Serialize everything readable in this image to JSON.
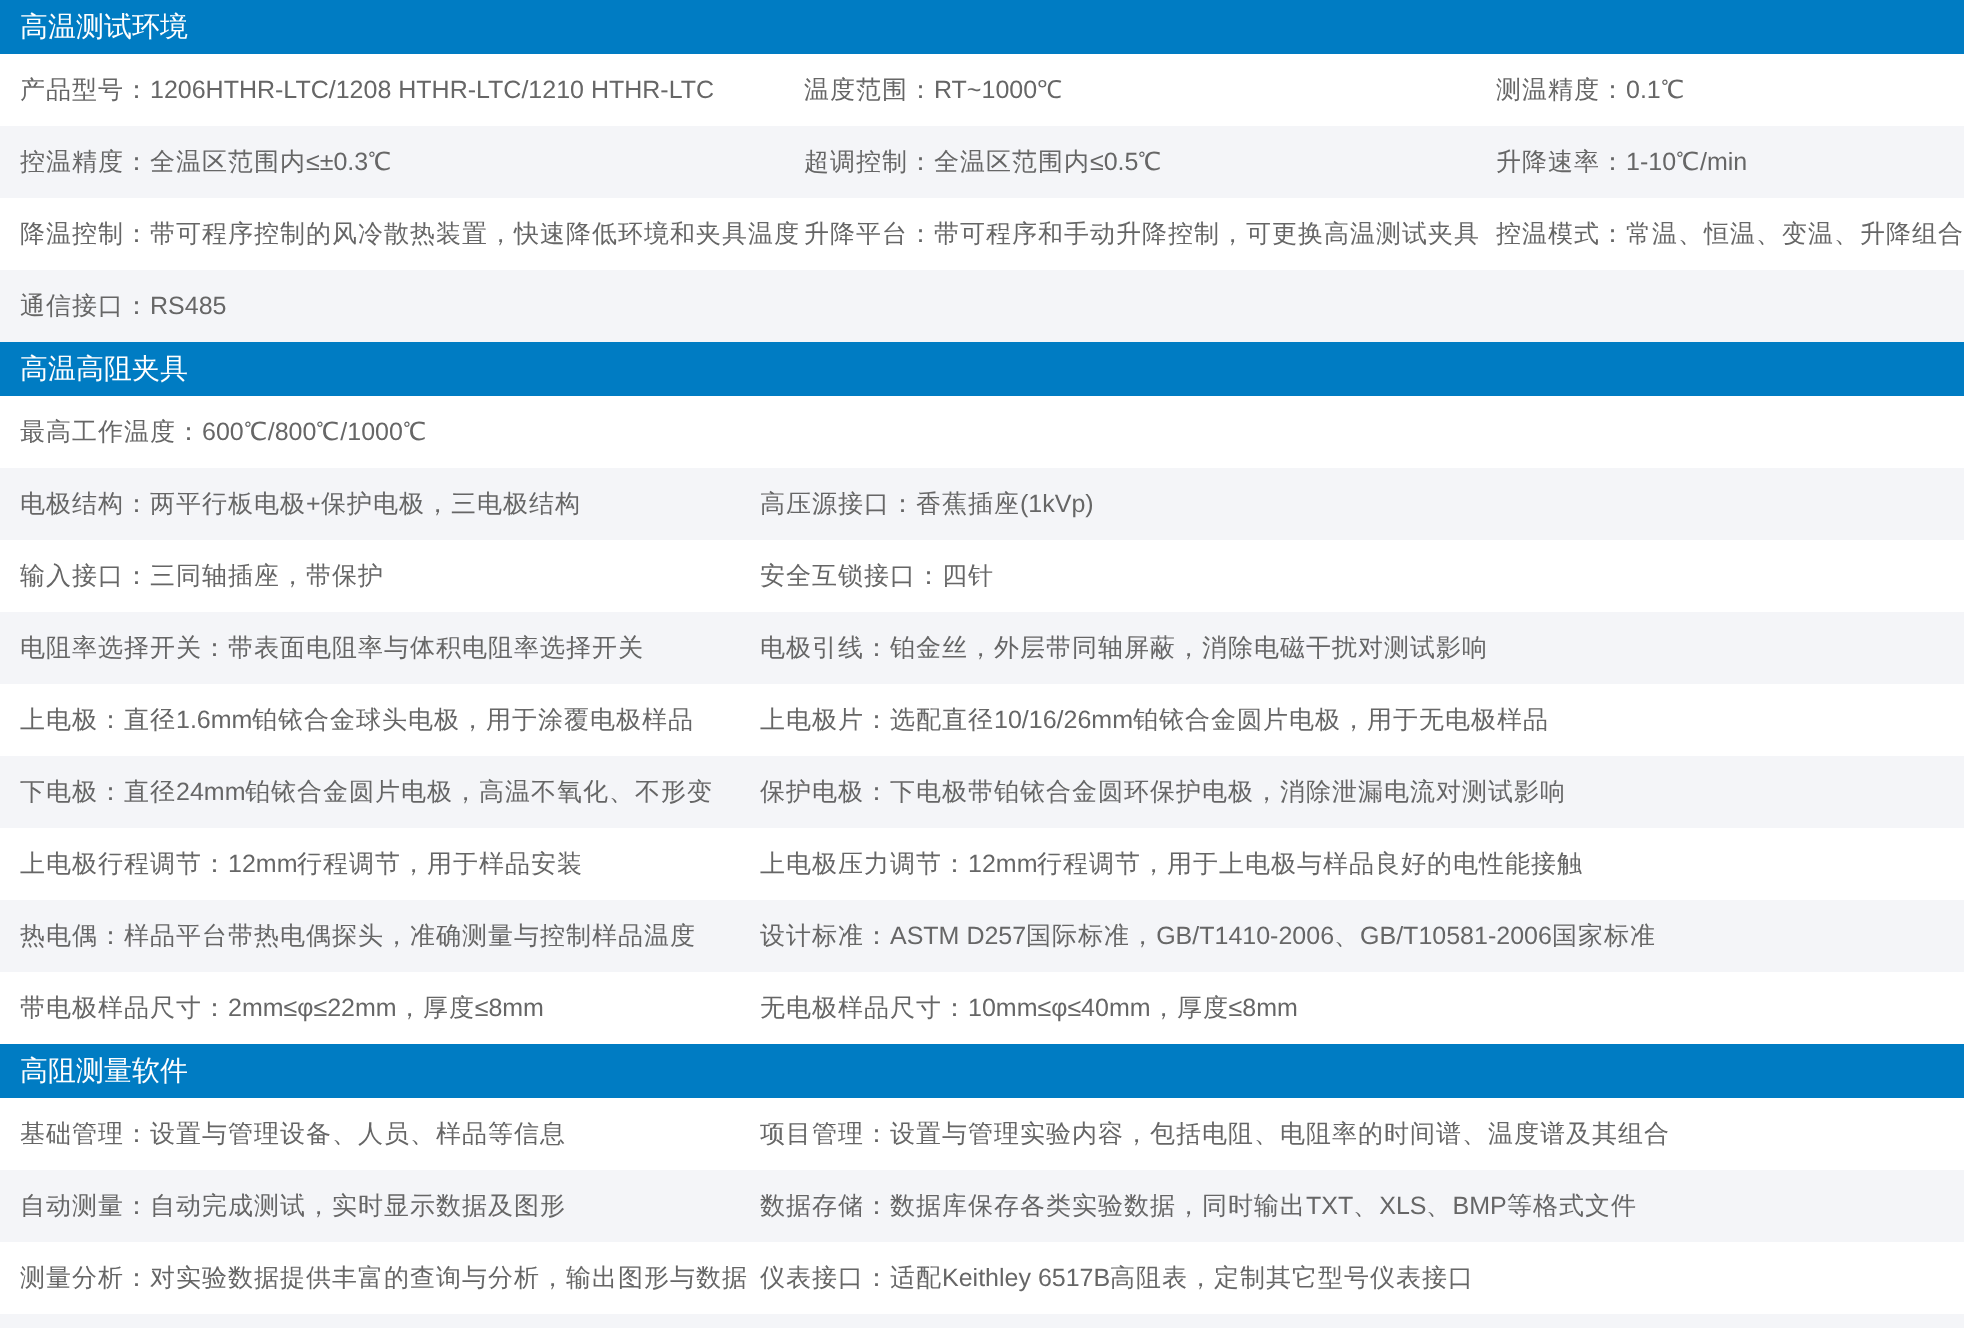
{
  "sections": [
    {
      "title": "高温测试环境",
      "kind": "three-column",
      "rows": [
        {
          "cells": [
            "产品型号：1206HTHR-LTC/1208 HTHR-LTC/1210 HTHR-LTC",
            "温度范围：RT~1000℃",
            "测温精度：0.1℃"
          ]
        },
        {
          "cells": [
            "控温精度：全温区范围内≤±0.3℃",
            "超调控制：全温区范围内≤0.5℃",
            "升降速率：1-10℃/min"
          ]
        },
        {
          "cells": [
            "降温控制：带可程序控制的风冷散热装置，快速降低环境和夹具温度",
            "升降平台：带可程序和手动升降控制，可更换高温测试夹具",
            "控温模式：常温、恒温、变温、升降组合"
          ]
        },
        {
          "cells": [
            "通信接口：RS485"
          ]
        }
      ]
    },
    {
      "title": "高温高阻夹具",
      "kind": "two-column",
      "rows": [
        {
          "cells": [
            "最高工作温度：600℃/800℃/1000℃"
          ]
        },
        {
          "cells": [
            "电极结构：两平行板电极+保护电极，三电极结构",
            "高压源接口：香蕉插座(1kVp)"
          ]
        },
        {
          "cells": [
            "输入接口：三同轴插座，带保护",
            "安全互锁接口：四针"
          ]
        },
        {
          "cells": [
            "电阻率选择开关：带表面电阻率与体积电阻率选择开关",
            "电极引线：铂金丝，外层带同轴屏蔽，消除电磁干扰对测试影响"
          ]
        },
        {
          "cells": [
            "上电极：直径1.6mm铂铱合金球头电极，用于涂覆电极样品",
            "上电极片：选配直径10/16/26mm铂铱合金圆片电极，用于无电极样品"
          ]
        },
        {
          "cells": [
            "下电极：直径24mm铂铱合金圆片电极，高温不氧化、不形变",
            "保护电极：下电极带铂铱合金圆环保护电极，消除泄漏电流对测试影响"
          ]
        },
        {
          "cells": [
            "上电极行程调节：12mm行程调节，用于样品安装",
            "上电极压力调节：12mm行程调节，用于上电极与样品良好的电性能接触"
          ]
        },
        {
          "cells": [
            "热电偶：样品平台带热电偶探头，准确测量与控制样品温度",
            "设计标准：ASTM D257国际标准，GB/T1410-2006、GB/T10581-2006国家标准"
          ]
        },
        {
          "cells": [
            "带电极样品尺寸：2mm≤φ≤22mm，厚度≤8mm",
            "无电极样品尺寸：10mm≤φ≤40mm，厚度≤8mm"
          ]
        }
      ]
    },
    {
      "title": "高阻测量软件",
      "kind": "two-column",
      "rows": [
        {
          "cells": [
            "基础管理：设置与管理设备、人员、样品等信息",
            "项目管理：设置与管理实验内容，包括电阻、电阻率的时间谱、温度谱及其组合"
          ]
        },
        {
          "cells": [
            "自动测量：自动完成测试，实时显示数据及图形",
            "数据存储：数据库保存各类实验数据，同时输出TXT、XLS、BMP等格式文件"
          ]
        },
        {
          "cells": [
            "测量分析：对实验数据提供丰富的查询与分析，输出图形与数据",
            "仪表接口：适配Keithley 6517B高阻表，定制其它型号仪表接口"
          ]
        }
      ]
    }
  ]
}
